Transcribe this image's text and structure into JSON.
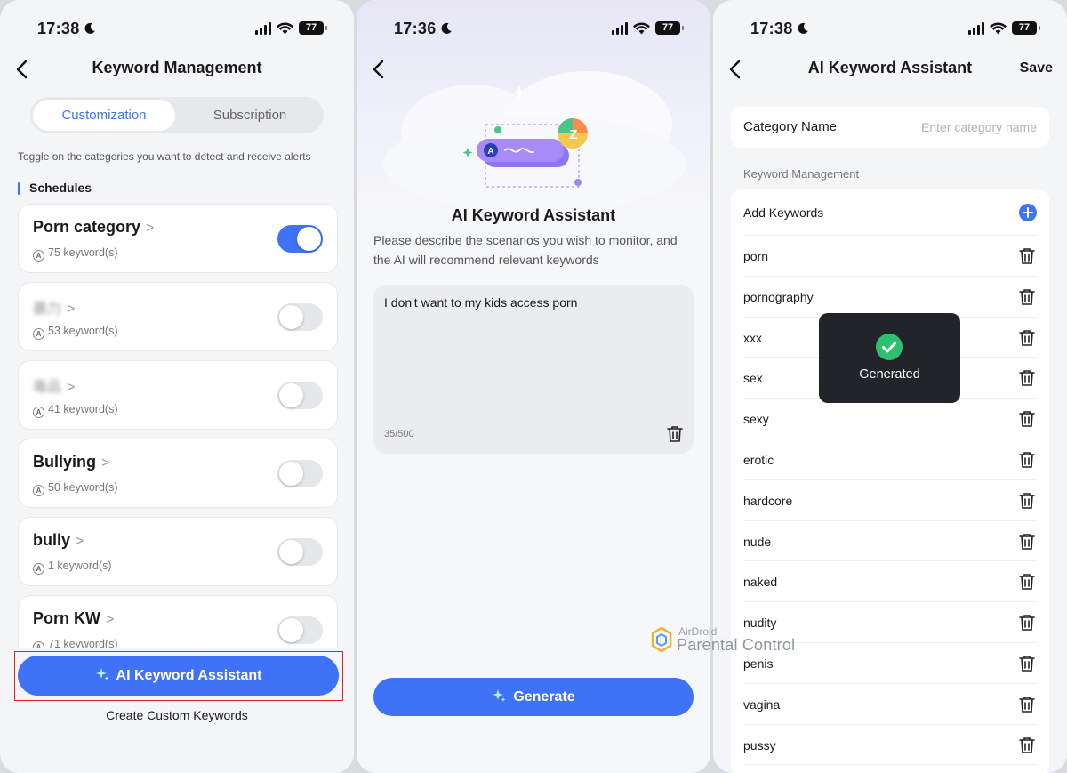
{
  "screen1": {
    "status": {
      "time": "17:38",
      "battery": "77"
    },
    "title": "Keyword Management",
    "tabs": [
      {
        "label": "Customization",
        "active": true
      },
      {
        "label": "Subscription",
        "active": false
      }
    ],
    "hint": "Toggle on the categories you want to detect and receive alerts",
    "section_title": "Schedules",
    "categories": [
      {
        "name": "Porn category",
        "count": "75 keyword(s)",
        "enabled": true,
        "blurred": false
      },
      {
        "name": "暴力",
        "count": "53 keyword(s)",
        "enabled": false,
        "blurred": true
      },
      {
        "name": "毒品",
        "count": "41 keyword(s)",
        "enabled": false,
        "blurred": true
      },
      {
        "name": "Bullying",
        "count": "50 keyword(s)",
        "enabled": false,
        "blurred": false
      },
      {
        "name": "bully",
        "count": "1 keyword(s)",
        "enabled": false,
        "blurred": false
      },
      {
        "name": "Porn KW",
        "count": "71 keyword(s)",
        "enabled": false,
        "blurred": false
      }
    ],
    "ai_button_label": "AI Keyword Assistant",
    "custom_link": "Create Custom Keywords",
    "accent_color": "#3f72f6",
    "highlight_color": "#e0212b"
  },
  "screen2": {
    "status": {
      "time": "17:36",
      "battery": "77"
    },
    "title": "AI Keyword Assistant",
    "description": "Please describe the scenarios you wish to monitor, and the AI will recommend relevant keywords",
    "input_value": "I don't want to my kids access porn",
    "char_count": "35/500",
    "generate_label": "Generate"
  },
  "screen3": {
    "status": {
      "time": "17:38",
      "battery": "77"
    },
    "title": "AI Keyword Assistant",
    "save_label": "Save",
    "category_label": "Category Name",
    "category_placeholder": "Enter category name",
    "section_label": "Keyword Management",
    "add_label": "Add Keywords",
    "keywords": [
      "porn",
      "pornography",
      "xxx",
      "sex",
      "sexy",
      "erotic",
      "hardcore",
      "nude",
      "naked",
      "nudity",
      "penis",
      "vagina",
      "pussy"
    ],
    "toast": "Generated"
  },
  "watermark": {
    "small": "AirDroid",
    "big": "Parental Control"
  }
}
